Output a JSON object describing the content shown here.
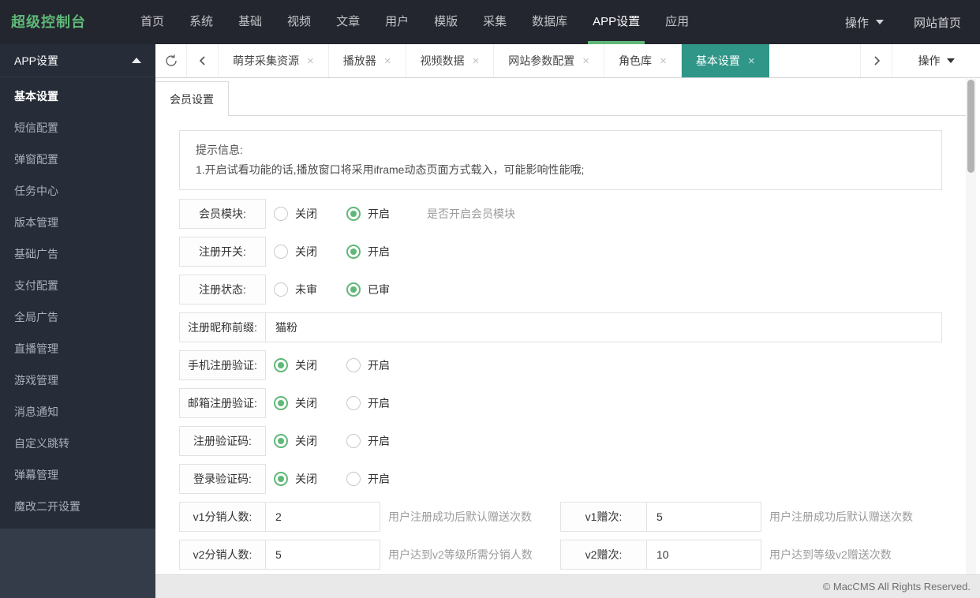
{
  "navbar": {
    "logo": "超级控制台",
    "items": [
      {
        "label": "首页",
        "active": false
      },
      {
        "label": "系统",
        "active": false
      },
      {
        "label": "基础",
        "active": false
      },
      {
        "label": "视频",
        "active": false
      },
      {
        "label": "文章",
        "active": false
      },
      {
        "label": "用户",
        "active": false
      },
      {
        "label": "模版",
        "active": false
      },
      {
        "label": "采集",
        "active": false
      },
      {
        "label": "数据库",
        "active": false
      },
      {
        "label": "APP设置",
        "active": true
      },
      {
        "label": "应用",
        "active": false
      }
    ],
    "action_label": "操作",
    "site_home_label": "网站首页"
  },
  "sidebar": {
    "header": "APP设置",
    "items": [
      {
        "label": "基本设置",
        "active": true
      },
      {
        "label": "短信配置",
        "active": false
      },
      {
        "label": "弹窗配置",
        "active": false
      },
      {
        "label": "任务中心",
        "active": false
      },
      {
        "label": "版本管理",
        "active": false
      },
      {
        "label": "基础广告",
        "active": false
      },
      {
        "label": "支付配置",
        "active": false
      },
      {
        "label": "全局广告",
        "active": false
      },
      {
        "label": "直播管理",
        "active": false
      },
      {
        "label": "游戏管理",
        "active": false
      },
      {
        "label": "消息通知",
        "active": false
      },
      {
        "label": "自定义跳转",
        "active": false
      },
      {
        "label": "弹幕管理",
        "active": false
      },
      {
        "label": "魔改二开设置",
        "active": false
      }
    ]
  },
  "tabbar": {
    "close_glyph": "×",
    "tabs": [
      {
        "label": "萌芽采集资源",
        "active": false
      },
      {
        "label": "播放器",
        "active": false
      },
      {
        "label": "视频数据",
        "active": false
      },
      {
        "label": "网站参数配置",
        "active": false
      },
      {
        "label": "角色库",
        "active": false
      },
      {
        "label": "基本设置",
        "active": true
      }
    ],
    "action_label": "操作"
  },
  "page": {
    "tab_label": "会员设置",
    "notice_title": "提示信息:",
    "notice_line": "1.开启试看功能的话,播放窗口将采用iframe动态页面方式载入，可能影响性能哦;",
    "radio_rows_top": [
      {
        "label": "会员模块:",
        "options": [
          "关闭",
          "开启"
        ],
        "selected": 1,
        "hint": "是否开启会员模块"
      },
      {
        "label": "注册开关:",
        "options": [
          "关闭",
          "开启"
        ],
        "selected": 1,
        "hint": ""
      },
      {
        "label": "注册状态:",
        "options": [
          "未审",
          "已审"
        ],
        "selected": 1,
        "hint": ""
      }
    ],
    "text_row": {
      "label": "注册昵称前缀:",
      "value": "猫粉"
    },
    "radio_rows_bottom": [
      {
        "label": "手机注册验证:",
        "options": [
          "关闭",
          "开启"
        ],
        "selected": 0,
        "hint": ""
      },
      {
        "label": "邮箱注册验证:",
        "options": [
          "关闭",
          "开启"
        ],
        "selected": 0,
        "hint": ""
      },
      {
        "label": "注册验证码:",
        "options": [
          "关闭",
          "开启"
        ],
        "selected": 0,
        "hint": ""
      },
      {
        "label": "登录验证码:",
        "options": [
          "关闭",
          "开启"
        ],
        "selected": 0,
        "hint": ""
      }
    ],
    "pair_rows": [
      {
        "left": {
          "label": "v1分销人数:",
          "value": "2",
          "hint": "用户注册成功后默认赠送次数"
        },
        "right": {
          "label": "v1赠次:",
          "value": "5",
          "hint": "用户注册成功后默认赠送次数"
        }
      },
      {
        "left": {
          "label": "v2分销人数:",
          "value": "5",
          "hint": "用户达到v2等级所需分销人数"
        },
        "right": {
          "label": "v2赠次:",
          "value": "10",
          "hint": "用户达到等级v2赠送次数"
        }
      }
    ]
  },
  "footer": {
    "copyright": "© MacCMS All Rights Reserved."
  },
  "colors": {
    "accent_green": "#5FB878",
    "active_tab_teal": "#2F9688",
    "navbar_bg": "#23262F",
    "sidebar_menu_bg": "#262C38",
    "sidebar_base_bg": "#353C49",
    "footer_bg": "#E9E9E9"
  }
}
